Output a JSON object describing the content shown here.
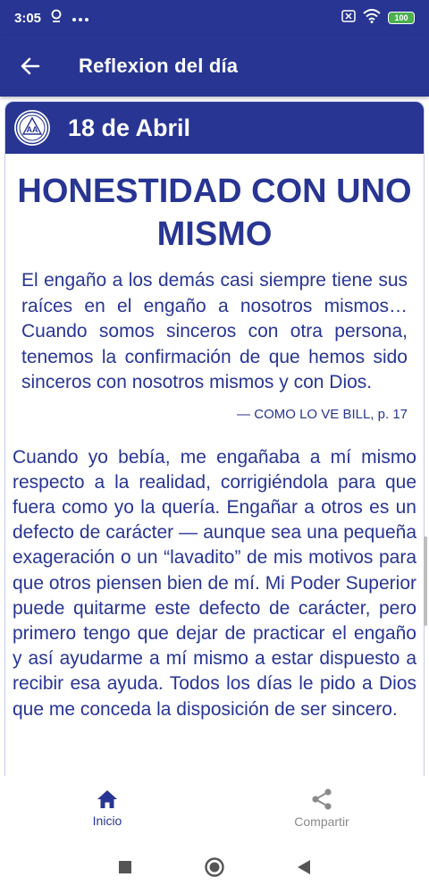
{
  "status_bar": {
    "time": "3:05",
    "battery": "100"
  },
  "app_bar": {
    "title": "Reflexion del día"
  },
  "card": {
    "logo_text": "AA",
    "date": "18 de Abril",
    "title": "HONESTIDAD CON UNO MISMO",
    "quote": "El engaño a los demás casi siempre tiene sus raíces en el engaño a nosotros mismos… Cuando somos sinceros con otra persona, tenemos la confirmación de que hemos sido sinceros con nosotros mismos y con Dios.",
    "quote_source": "— COMO LO VE BILL, p. 17",
    "body": "Cuando yo bebía, me engañaba a mí mismo respecto a la realidad, corrigiéndola para que fuera como yo la quería. Engañar a otros es un defecto de carácter — aunque sea una pequeña exageración o un “lavadito” de mis motivos para que otros piensen bien de mí. Mi Poder Superior puede quitarme este defecto de carácter, pero primero tengo que dejar de practicar el engaño y así ayudarme a mí mismo a estar dispuesto a recibir esa ayuda. Todos los días le pido a Dios que me conceda la disposición de ser sincero."
  },
  "bottom_nav": {
    "items": [
      {
        "label": "Inicio",
        "icon": "home-icon",
        "active": true
      },
      {
        "label": "Compartir",
        "icon": "share-icon",
        "active": false
      }
    ]
  },
  "colors": {
    "primary": "#283593",
    "inactive": "#8a8a8a"
  }
}
